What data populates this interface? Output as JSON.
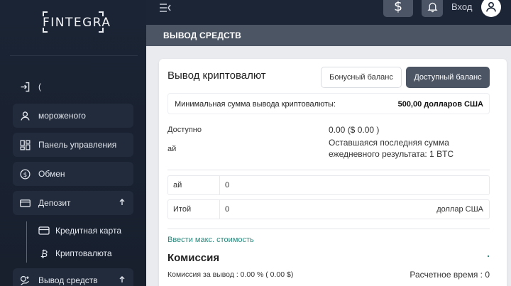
{
  "brand": {
    "logo_text": "FINTEGRA"
  },
  "sidebar": {
    "items": [
      {
        "label": "(",
        "icon": "login-icon"
      },
      {
        "label": "мороженого",
        "icon": "user-icon"
      },
      {
        "label": "Панель управления",
        "icon": "dashboard-icon"
      },
      {
        "label": "Обмен",
        "icon": "exchange-icon"
      },
      {
        "label": "Депозит",
        "icon": "card-icon"
      },
      {
        "label": "Вывод средств",
        "icon": "withdraw-icon"
      }
    ],
    "sub_items": [
      {
        "label": "Кредитная карта",
        "icon": "credit-card-icon"
      },
      {
        "label": "Криптовалюта",
        "icon": "bitcoin-icon"
      }
    ]
  },
  "topbar": {
    "dollar_glyph": "$",
    "login_label": "Вход"
  },
  "section": {
    "title": "ВЫВОД СРЕДСТВ"
  },
  "card": {
    "title": "Вывод криптовалют",
    "bonus_button": "Бонусный баланс",
    "available_button": "Доступный баланс",
    "min_label": "Минимальная сумма вывода криптовалюты:",
    "min_value": "500,00 долларов США",
    "available_label": "Доступно",
    "available_value": "0.00 ($ 0.00 )",
    "ai_label": "ай",
    "remaining_text": "Оставшаяся последняя сумма ежедневного результата: 1 BTC",
    "field1": {
      "label": "ай",
      "value": "0"
    },
    "field2": {
      "label": "Итой",
      "value": "0",
      "unit": "доллар США"
    },
    "max_link": "Ввести макс. стоимость",
    "fee_title": "Комиссия",
    "fee_text": "Комиссия за вывод : 0.00 % ( 0.00 $)",
    "calc_time": "Расчетное время : 0"
  },
  "colors": {
    "sidebar_bg": "#1b2434",
    "topbar_bg": "#1c2535",
    "header_bg": "#4c5564",
    "accent_link": "#2b8a7e"
  }
}
